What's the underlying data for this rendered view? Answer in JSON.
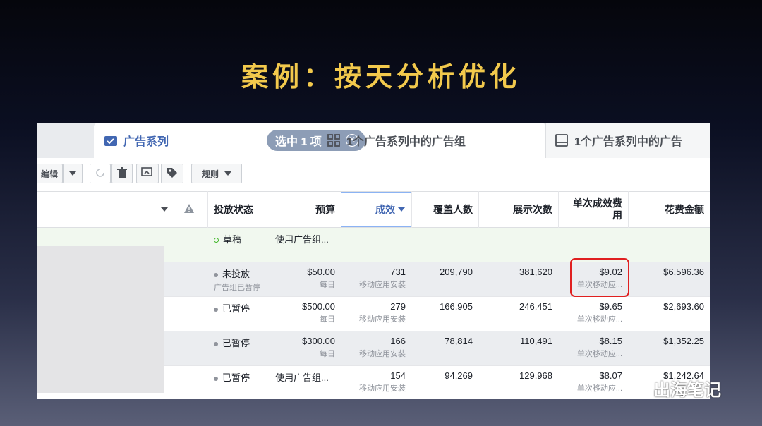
{
  "slide": {
    "title": "案例：按天分析优化"
  },
  "tabs": {
    "campaign": "广告系列",
    "selected": "选中 1 项",
    "adsets": "1个广告系列中的广告组",
    "ads": "1个广告系列中的广告"
  },
  "toolbar": {
    "edit": "编辑",
    "rules": "规则"
  },
  "icons": {
    "campaign": "checkbox-folder-icon",
    "adsets": "grid-icon",
    "ads": "ad-preview-icon",
    "refresh": "refresh-icon",
    "delete": "trash-icon",
    "duplicate": "duplicate-icon",
    "tag": "tag-icon",
    "warning": "warning-icon",
    "wechat": "wechat-logo-icon"
  },
  "table": {
    "headers": {
      "status": "投放状态",
      "budget": "预算",
      "results": "成效",
      "reach": "覆盖人数",
      "impressions": "展示次数",
      "cpr": "单次成效费用",
      "spend": "花费金额"
    },
    "rows": [
      {
        "status": "草稿",
        "status_note": "",
        "budget": "使用广告组...",
        "budget_note": "",
        "results": "—",
        "results_note": "",
        "reach": "—",
        "impressions": "—",
        "cpr": "—",
        "cpr_note": "",
        "spend": "—"
      },
      {
        "status": "未投放",
        "status_note": "广告组已暂停",
        "budget": "$50.00",
        "budget_note": "每日",
        "results": "731",
        "results_note": "移动应用安装",
        "reach": "209,790",
        "impressions": "381,620",
        "cpr": "$9.02",
        "cpr_note": "单次移动应...",
        "spend": "$6,596.36"
      },
      {
        "status": "已暂停",
        "status_note": "",
        "budget": "$500.00",
        "budget_note": "每日",
        "results": "279",
        "results_note": "移动应用安装",
        "reach": "166,905",
        "impressions": "246,451",
        "cpr": "$9.65",
        "cpr_note": "单次移动应...",
        "spend": "$2,693.60"
      },
      {
        "status": "已暂停",
        "status_note": "",
        "budget": "$300.00",
        "budget_note": "每日",
        "results": "166",
        "results_note": "移动应用安装",
        "reach": "78,814",
        "impressions": "110,491",
        "cpr": "$8.15",
        "cpr_note": "单次移动应...",
        "spend": "$1,352.25"
      },
      {
        "status": "已暂停",
        "status_note": "",
        "budget": "使用广告组...",
        "budget_note": "",
        "results": "154",
        "results_note": "移动应用安装",
        "reach": "94,269",
        "impressions": "129,968",
        "cpr": "$8.07",
        "cpr_note": "单次移动应...",
        "spend": "$1,242.64"
      }
    ]
  },
  "watermark": {
    "text": "出海笔记"
  },
  "colors": {
    "title": "#f2c94c",
    "accent": "#4267b2",
    "highlight": "#e02020"
  }
}
